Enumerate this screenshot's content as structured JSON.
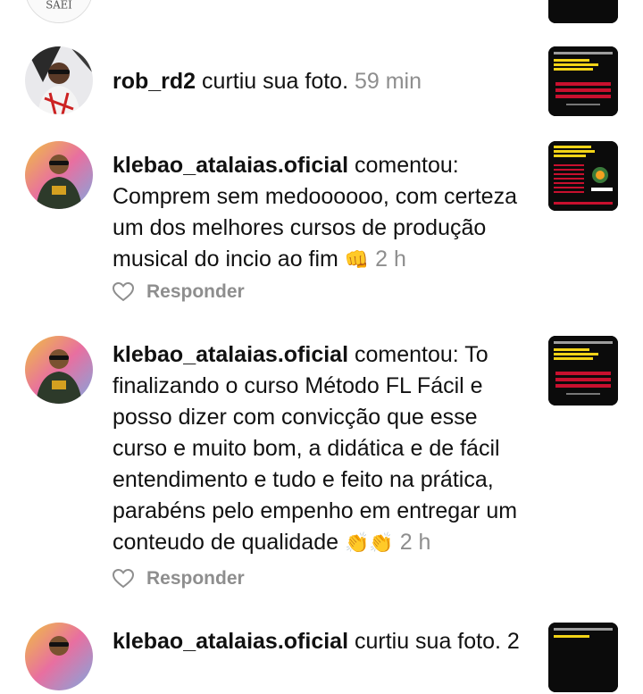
{
  "notifications": [
    {
      "user": "rob_rd2",
      "action": " curtiu sua foto. ",
      "time": "59 min"
    },
    {
      "user": "klebao_atalaias.oficial",
      "action": " comentou: ",
      "comment": "Comprem sem medoooooo, com certeza um dos melhores cursos de produção musical do incio ao fim ",
      "emoji": "👊",
      "time": " 2 h",
      "reply_label": "Responder",
      "thumb_title": "TRAVADO NA HORA DE FINALIZAR AS SUAS PRODUÇÕES?",
      "thumb_brand": "FL FÁCIL"
    },
    {
      "user": "klebao_atalaias.oficial",
      "action": " comentou: ",
      "comment": "To finalizando o curso Método FL Fácil e posso dizer com convicção que esse curso e muito bom, a didática e de fácil entendimento e tudo e feito na prática, parabéns pelo empenho em entregar um conteudo de qualidade ",
      "emoji": "👏👏",
      "time": " 2 h",
      "reply_label": "Responder"
    },
    {
      "user": "klebao_atalaias.oficial",
      "action": " curtiu sua foto. 2"
    }
  ],
  "top_partial": {
    "avatar_text": "SAEI"
  },
  "colors": {
    "text": "#111111",
    "muted": "#8e8e8e",
    "thumb_bg": "#0b0b0b",
    "thumb_accent": "#c8102e",
    "thumb_yellow": "#f3d417"
  }
}
